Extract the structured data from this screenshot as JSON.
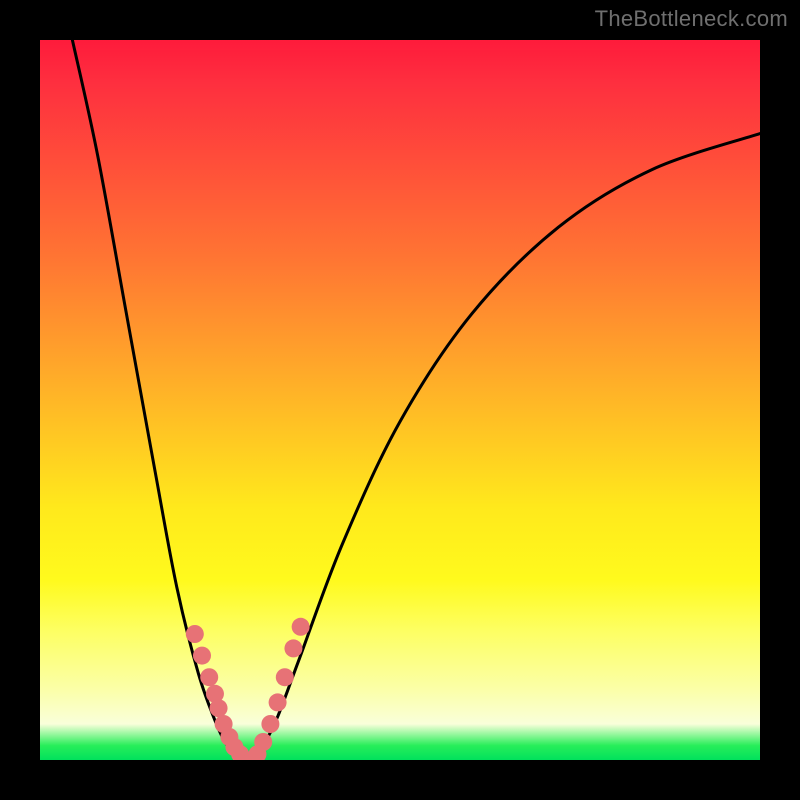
{
  "watermark": "TheBottleneck.com",
  "chart_data": {
    "type": "line",
    "title": "",
    "xlabel": "",
    "ylabel": "",
    "xlim": [
      0,
      1
    ],
    "ylim": [
      0,
      1
    ],
    "curve_left": {
      "x": [
        0.045,
        0.08,
        0.12,
        0.16,
        0.19,
        0.22,
        0.245,
        0.26,
        0.275,
        0.285
      ],
      "y": [
        1.0,
        0.84,
        0.62,
        0.4,
        0.24,
        0.12,
        0.05,
        0.02,
        0.005,
        0.0
      ]
    },
    "curve_right": {
      "x": [
        0.295,
        0.31,
        0.33,
        0.36,
        0.42,
        0.5,
        0.6,
        0.72,
        0.85,
        1.0
      ],
      "y": [
        0.0,
        0.02,
        0.06,
        0.14,
        0.3,
        0.47,
        0.62,
        0.74,
        0.82,
        0.87
      ]
    },
    "dots": [
      {
        "x": 0.215,
        "y": 0.175
      },
      {
        "x": 0.225,
        "y": 0.145
      },
      {
        "x": 0.235,
        "y": 0.115
      },
      {
        "x": 0.243,
        "y": 0.092
      },
      {
        "x": 0.248,
        "y": 0.072
      },
      {
        "x": 0.255,
        "y": 0.05
      },
      {
        "x": 0.263,
        "y": 0.032
      },
      {
        "x": 0.27,
        "y": 0.018
      },
      {
        "x": 0.278,
        "y": 0.008
      },
      {
        "x": 0.285,
        "y": 0.0
      },
      {
        "x": 0.295,
        "y": 0.0
      },
      {
        "x": 0.302,
        "y": 0.008
      },
      {
        "x": 0.31,
        "y": 0.025
      },
      {
        "x": 0.32,
        "y": 0.05
      },
      {
        "x": 0.33,
        "y": 0.08
      },
      {
        "x": 0.34,
        "y": 0.115
      },
      {
        "x": 0.352,
        "y": 0.155
      },
      {
        "x": 0.362,
        "y": 0.185
      }
    ],
    "colors": {
      "curve": "#000000",
      "dot": "#e77276"
    }
  }
}
